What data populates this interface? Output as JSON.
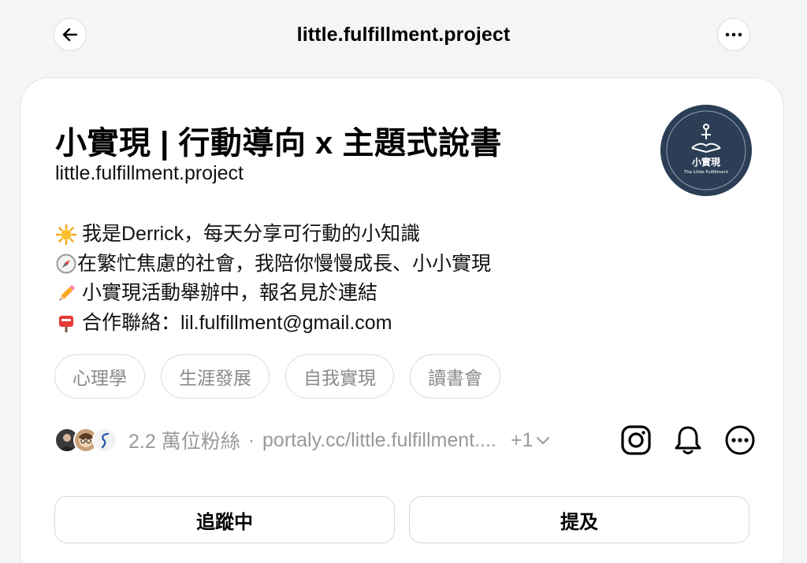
{
  "topbar": {
    "back_icon": "arrow-left-icon",
    "title": "little.fulfillment.project",
    "more_icon": "ellipsis-icon"
  },
  "profile": {
    "name": "小實現 | 行動導向 x 主題式說書",
    "handle": "little.fulfillment.project",
    "avatar": {
      "title": "小實現",
      "subtitle": "The Little Fulfillment",
      "bg_color": "#2c3e55"
    },
    "bio": [
      {
        "icon": "sun-emoji-icon",
        "text": "我是Derrick，每天分享可行動的小知識"
      },
      {
        "icon": "compass-emoji-icon",
        "text": "在繁忙焦慮的社會，我陪你慢慢成長、小小實現"
      },
      {
        "icon": "pencil-emoji-icon",
        "text": "小實現活動舉辦中，報名見於連結"
      },
      {
        "icon": "mailbox-emoji-icon",
        "text": "合作聯絡：lil.fulfillment@gmail.com"
      }
    ],
    "tags": [
      "心理學",
      "生涯發展",
      "自我實現",
      "讀書會"
    ],
    "followers_text": "2.2 萬位粉絲",
    "separator": "·",
    "link_text": "portaly.cc/little.fulfillment....",
    "more_links": "+1",
    "buttons": {
      "following": "追蹤中",
      "mention": "提及"
    }
  }
}
